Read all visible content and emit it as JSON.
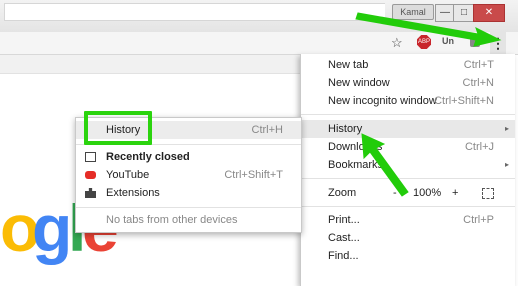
{
  "window": {
    "user_button_label": "Kamal",
    "minimize_glyph": "—",
    "maximize_glyph": "□",
    "close_glyph": "✕"
  },
  "toolbar": {
    "star_glyph": "☆",
    "adblock_label": "ABP",
    "extension_label": "Un",
    "menu_glyph": "⋮"
  },
  "google_logo_fragment": [
    "o",
    "g",
    "l",
    "e"
  ],
  "google_logo_colors": [
    "#fbbc05",
    "#4285f4",
    "#34a853",
    "#ea4335"
  ],
  "main_menu": {
    "items": [
      {
        "label": "New tab",
        "shortcut": "Ctrl+T"
      },
      {
        "label": "New window",
        "shortcut": "Ctrl+N"
      },
      {
        "label": "New incognito window",
        "shortcut": "Ctrl+Shift+N"
      },
      {
        "label": "History",
        "arrow": "▸"
      },
      {
        "label": "Downloads",
        "shortcut": "Ctrl+J"
      },
      {
        "label": "Bookmarks",
        "arrow": "▸"
      },
      {
        "label": "Print...",
        "shortcut": "Ctrl+P"
      },
      {
        "label": "Cast..."
      },
      {
        "label": "Find..."
      }
    ],
    "zoom": {
      "label": "Zoom",
      "minus": "-",
      "value": "100%",
      "plus": "+"
    }
  },
  "history_submenu": {
    "history": {
      "label": "History",
      "shortcut": "Ctrl+H"
    },
    "recently_closed": "Recently closed",
    "youtube": {
      "label": "YouTube",
      "shortcut": "Ctrl+Shift+T"
    },
    "extensions": "Extensions",
    "no_tabs": "No tabs from other devices"
  },
  "accent_colors": {
    "highlight": "#2bd40e",
    "arrow": "#22cc0a"
  }
}
